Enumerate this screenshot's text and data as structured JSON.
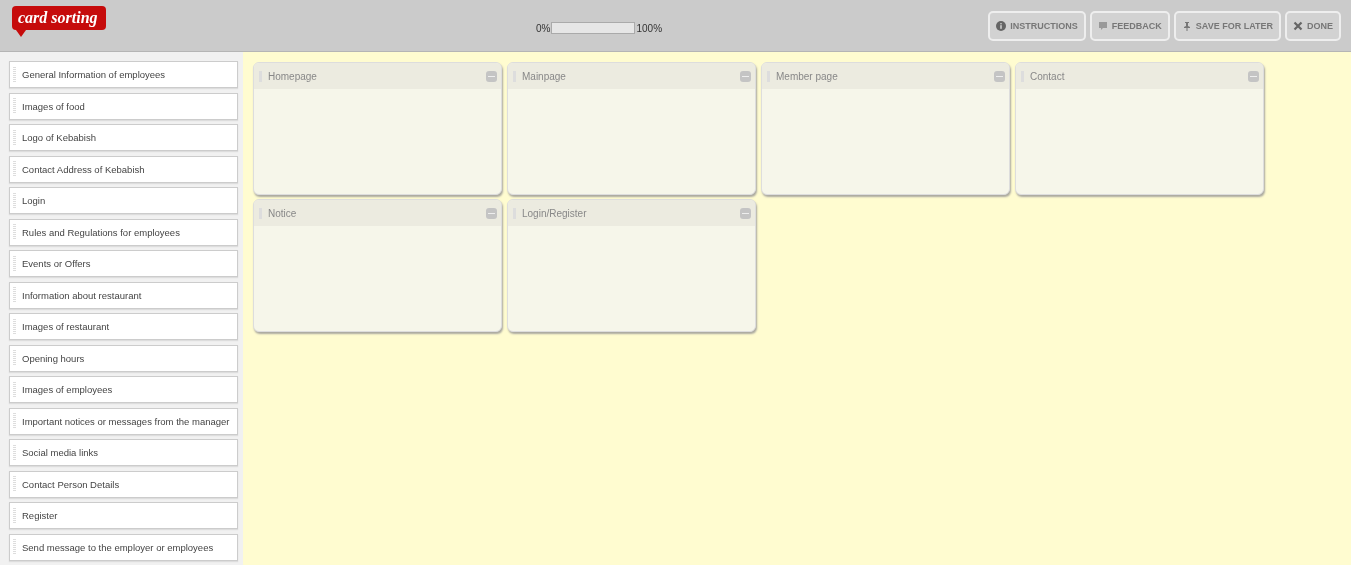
{
  "logo": "card sorting",
  "progress": {
    "start_label": "0%",
    "end_label": "100%",
    "level": 0
  },
  "buttons": [
    {
      "kind": "info",
      "label": "INSTRUCTIONS"
    },
    {
      "kind": "feedback",
      "label": "FEEDBACK"
    },
    {
      "kind": "pin",
      "label": "SAVE FOR LATER"
    },
    {
      "kind": "close",
      "label": "DONE"
    }
  ],
  "cards": [
    "General Information of employees",
    "Images of food",
    "Logo of Kebabish",
    "Contact Address of Kebabish",
    "Login",
    "Rules and Regulations for employees",
    "Events or Offers",
    "Information about restaurant",
    "Images of restaurant",
    "Opening hours",
    "Images of employees",
    "Important notices or messages from the manager",
    "Social media links",
    "Contact Person Details",
    "Register",
    "Send message to the employer or employees"
  ],
  "groups": [
    {
      "title": "Homepage"
    },
    {
      "title": "Mainpage"
    },
    {
      "title": "Member page"
    },
    {
      "title": "Contact"
    },
    {
      "title": "Notice"
    },
    {
      "title": "Login/Register"
    }
  ]
}
